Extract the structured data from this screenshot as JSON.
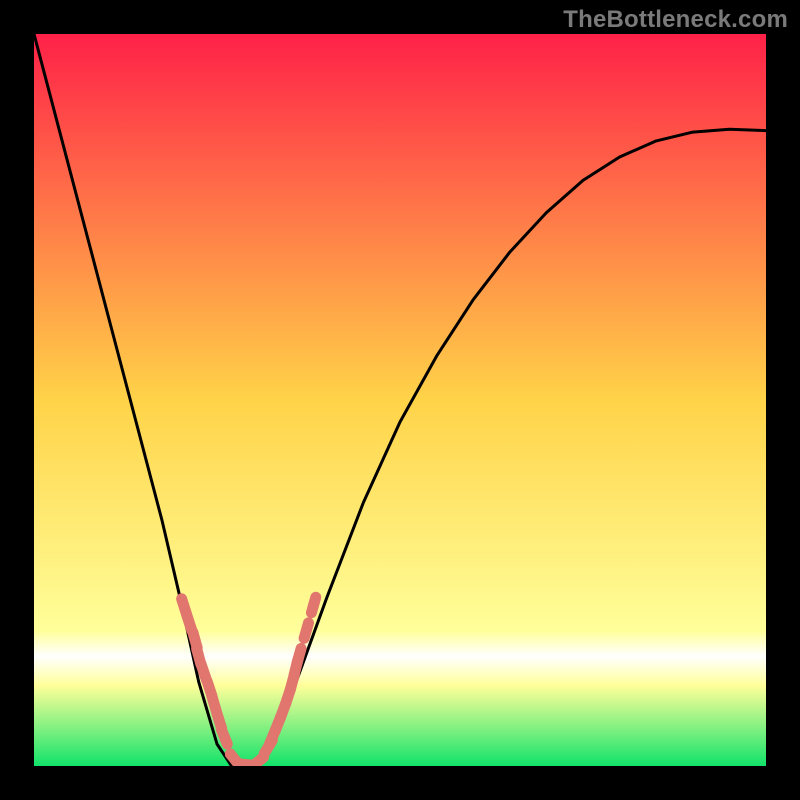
{
  "watermark": "TheBottleneck.com",
  "colors": {
    "frame": "#000000",
    "gradient_top": "#ff2148",
    "gradient_mid": "#ffd348",
    "whiteband_top": "#ffff9a",
    "whiteband_mid": "#ffffff",
    "gradient_bottom": "#11e36a",
    "curve": "#000000",
    "markers": "#e0766e"
  },
  "chart_data": {
    "type": "line",
    "title": "",
    "xlabel": "",
    "ylabel": "",
    "xlim": [
      0,
      1
    ],
    "ylim": [
      0,
      1
    ],
    "series": [
      {
        "name": "bottleneck-curve",
        "x": [
          0.0,
          0.025,
          0.05,
          0.075,
          0.1,
          0.125,
          0.15,
          0.175,
          0.2,
          0.225,
          0.25,
          0.27,
          0.3,
          0.33,
          0.36,
          0.4,
          0.45,
          0.5,
          0.55,
          0.6,
          0.65,
          0.7,
          0.75,
          0.8,
          0.85,
          0.9,
          0.95,
          1.0
        ],
        "y": [
          1.0,
          0.905,
          0.81,
          0.715,
          0.62,
          0.525,
          0.43,
          0.335,
          0.228,
          0.115,
          0.03,
          0.0,
          0.0,
          0.04,
          0.12,
          0.23,
          0.36,
          0.47,
          0.56,
          0.637,
          0.702,
          0.756,
          0.8,
          0.832,
          0.854,
          0.866,
          0.87,
          0.868
        ]
      }
    ],
    "markers": {
      "name": "sampled-points",
      "x": [
        0.205,
        0.212,
        0.22,
        0.225,
        0.232,
        0.24,
        0.246,
        0.253,
        0.26,
        0.275,
        0.29,
        0.305,
        0.32,
        0.326,
        0.333,
        0.34,
        0.347,
        0.353,
        0.358,
        0.362,
        0.372,
        0.382
      ],
      "y": [
        0.218,
        0.196,
        0.172,
        0.15,
        0.128,
        0.105,
        0.085,
        0.062,
        0.04,
        0.008,
        0.002,
        0.005,
        0.026,
        0.04,
        0.057,
        0.075,
        0.095,
        0.115,
        0.135,
        0.15,
        0.185,
        0.22
      ]
    },
    "gradient_stops": [
      {
        "offset": 0.0,
        "key": "gradient_top"
      },
      {
        "offset": 0.5,
        "key": "gradient_mid"
      },
      {
        "offset": 0.815,
        "key": "whiteband_top"
      },
      {
        "offset": 0.85,
        "key": "whiteband_mid"
      },
      {
        "offset": 0.89,
        "key": "whiteband_top"
      },
      {
        "offset": 1.0,
        "key": "gradient_bottom"
      }
    ]
  }
}
